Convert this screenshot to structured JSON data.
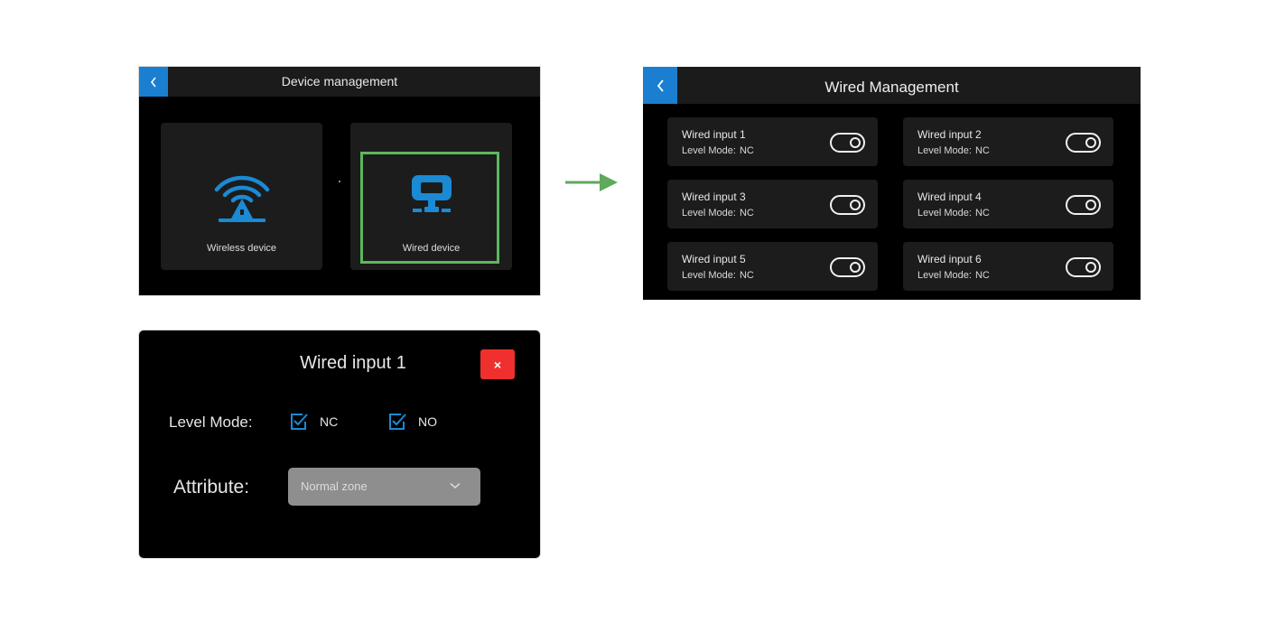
{
  "device_management": {
    "title": "Device management",
    "cards": [
      {
        "label": "Wireless device",
        "icon": "wireless-tower-icon"
      },
      {
        "label": "Wired device",
        "icon": "wired-device-icon",
        "selected": true
      }
    ]
  },
  "wired_management": {
    "title": "Wired Management",
    "level_mode_label": "Level Mode:",
    "inputs": [
      {
        "name": "Wired input 1",
        "mode": "NC"
      },
      {
        "name": "Wired input 2",
        "mode": "NC"
      },
      {
        "name": "Wired input 3",
        "mode": "NC"
      },
      {
        "name": "Wired input 4",
        "mode": "NC"
      },
      {
        "name": "Wired input 5",
        "mode": "NC"
      },
      {
        "name": "Wired input 6",
        "mode": "NC"
      }
    ]
  },
  "wired_input_dialog": {
    "title": "Wired input 1",
    "close_symbol": "×",
    "level_mode_label": "Level Mode:",
    "options": [
      {
        "label": "NC",
        "checked": true
      },
      {
        "label": "NO",
        "checked": true
      }
    ],
    "attribute_label": "Attribute:",
    "attribute_value": "Normal zone"
  },
  "colors": {
    "accent_blue": "#1a7fd0",
    "selected_green": "#5cb85c",
    "arrow_green": "#5fa85c",
    "close_red": "#f0302e"
  }
}
